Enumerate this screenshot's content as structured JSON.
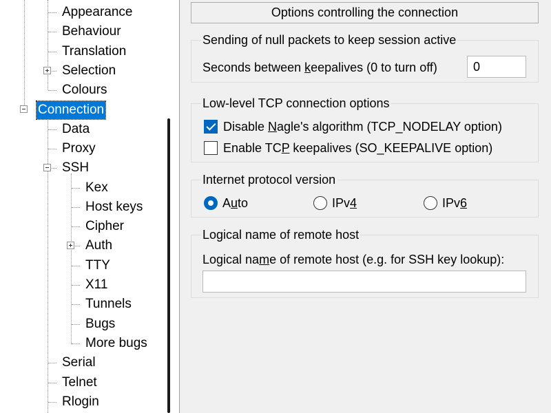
{
  "tree": {
    "appearance": "Appearance",
    "behaviour": "Behaviour",
    "translation": "Translation",
    "selection": "Selection",
    "colours": "Colours",
    "connection": "Connection",
    "data": "Data",
    "proxy": "Proxy",
    "ssh": "SSH",
    "kex": "Kex",
    "hostkeys": "Host keys",
    "cipher": "Cipher",
    "auth": "Auth",
    "tty": "TTY",
    "x11": "X11",
    "tunnels": "Tunnels",
    "bugs": "Bugs",
    "morebugs": "More bugs",
    "serial": "Serial",
    "telnet": "Telnet",
    "rlogin": "Rlogin"
  },
  "panel": {
    "title": "Options controlling the connection",
    "keepalive": {
      "group_title": "Sending of null packets to keep session active",
      "label_pre": "Seconds between ",
      "label_key": "k",
      "label_post": "eepalives (0 to turn off)",
      "value": "0"
    },
    "tcp": {
      "group_title": "Low-level TCP connection options",
      "nagle_pre": "Disable ",
      "nagle_key": "N",
      "nagle_post": "agle's algorithm (TCP_NODELAY option)",
      "nagle_checked": true,
      "keepalive_pre": "Enable TC",
      "keepalive_key": "P",
      "keepalive_post": " keepalives (SO_KEEPALIVE option)",
      "keepalive_checked": false
    },
    "ip": {
      "group_title": "Internet protocol version",
      "auto_pre": "A",
      "auto_key": "u",
      "auto_post": "to",
      "ipv4_pre": "IPv",
      "ipv4_key": "4",
      "ipv6_pre": "IPv",
      "ipv6_key": "6",
      "selected": "Auto"
    },
    "remote": {
      "group_title": "Logical name of remote host",
      "label_pre": "Logical na",
      "label_key": "m",
      "label_post": "e of remote host (e.g. for SSH key lookup):",
      "value": ""
    }
  },
  "colors": {
    "selection": "#0078d7",
    "checkbox_accent": "#0067c0"
  }
}
